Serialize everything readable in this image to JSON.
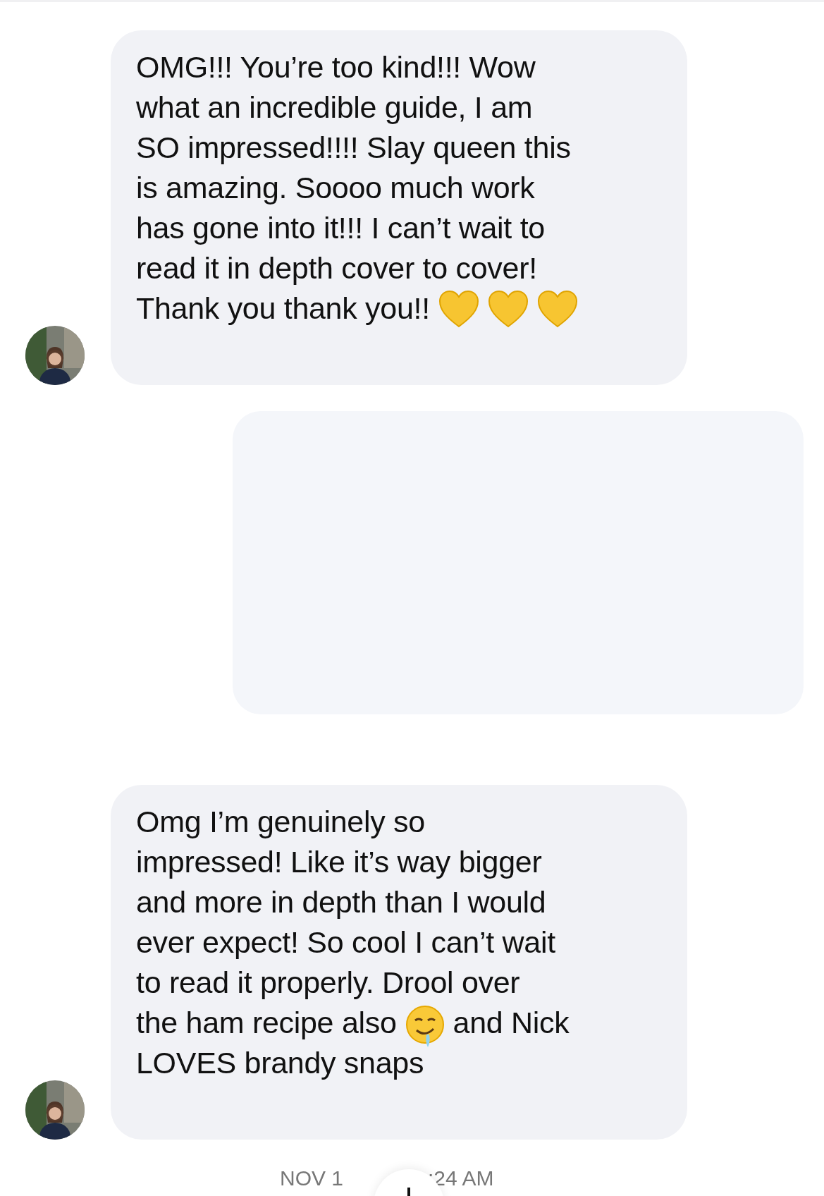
{
  "messages": [
    {
      "kind": "incoming",
      "lines": [
        [
          {
            "kind": "text",
            "text": "OMG!!! You’re too kind!!! Wow"
          }
        ],
        [
          {
            "kind": "text",
            "text": "what an incredible guide, I am"
          }
        ],
        [
          {
            "kind": "text",
            "text": "SO impressed!!!! Slay queen this"
          }
        ],
        [
          {
            "kind": "text",
            "text": "is amazing. Soooo much work"
          }
        ],
        [
          {
            "kind": "text",
            "text": "has gone into it!!! I can’t wait to"
          }
        ],
        [
          {
            "kind": "text",
            "text": "read it in depth cover to cover!"
          }
        ],
        [
          {
            "kind": "text",
            "text": "Thank you thank you!!"
          },
          {
            "kind": "heart"
          },
          {
            "kind": "heart"
          },
          {
            "kind": "heart"
          }
        ]
      ]
    },
    {
      "kind": "faded"
    },
    {
      "kind": "incoming",
      "lines": [
        [
          {
            "kind": "text",
            "text": "Omg I’m genuinely so"
          }
        ],
        [
          {
            "kind": "text",
            "text": "impressed! Like it’s way bigger"
          }
        ],
        [
          {
            "kind": "text",
            "text": "and more in depth than I would"
          }
        ],
        [
          {
            "kind": "text",
            "text": "ever expect! So cool I can’t wait"
          }
        ],
        [
          {
            "kind": "text",
            "text": "to read it properly. Drool over"
          }
        ],
        [
          {
            "kind": "text",
            "text": "the ham recipe also"
          },
          {
            "kind": "drool"
          },
          {
            "kind": "text",
            "text": "and Nick"
          }
        ],
        [
          {
            "kind": "text",
            "text": "LOVES brandy snaps"
          }
        ]
      ]
    }
  ],
  "timestamp": {
    "left": "NOV 1",
    "right": ":24 AM"
  }
}
